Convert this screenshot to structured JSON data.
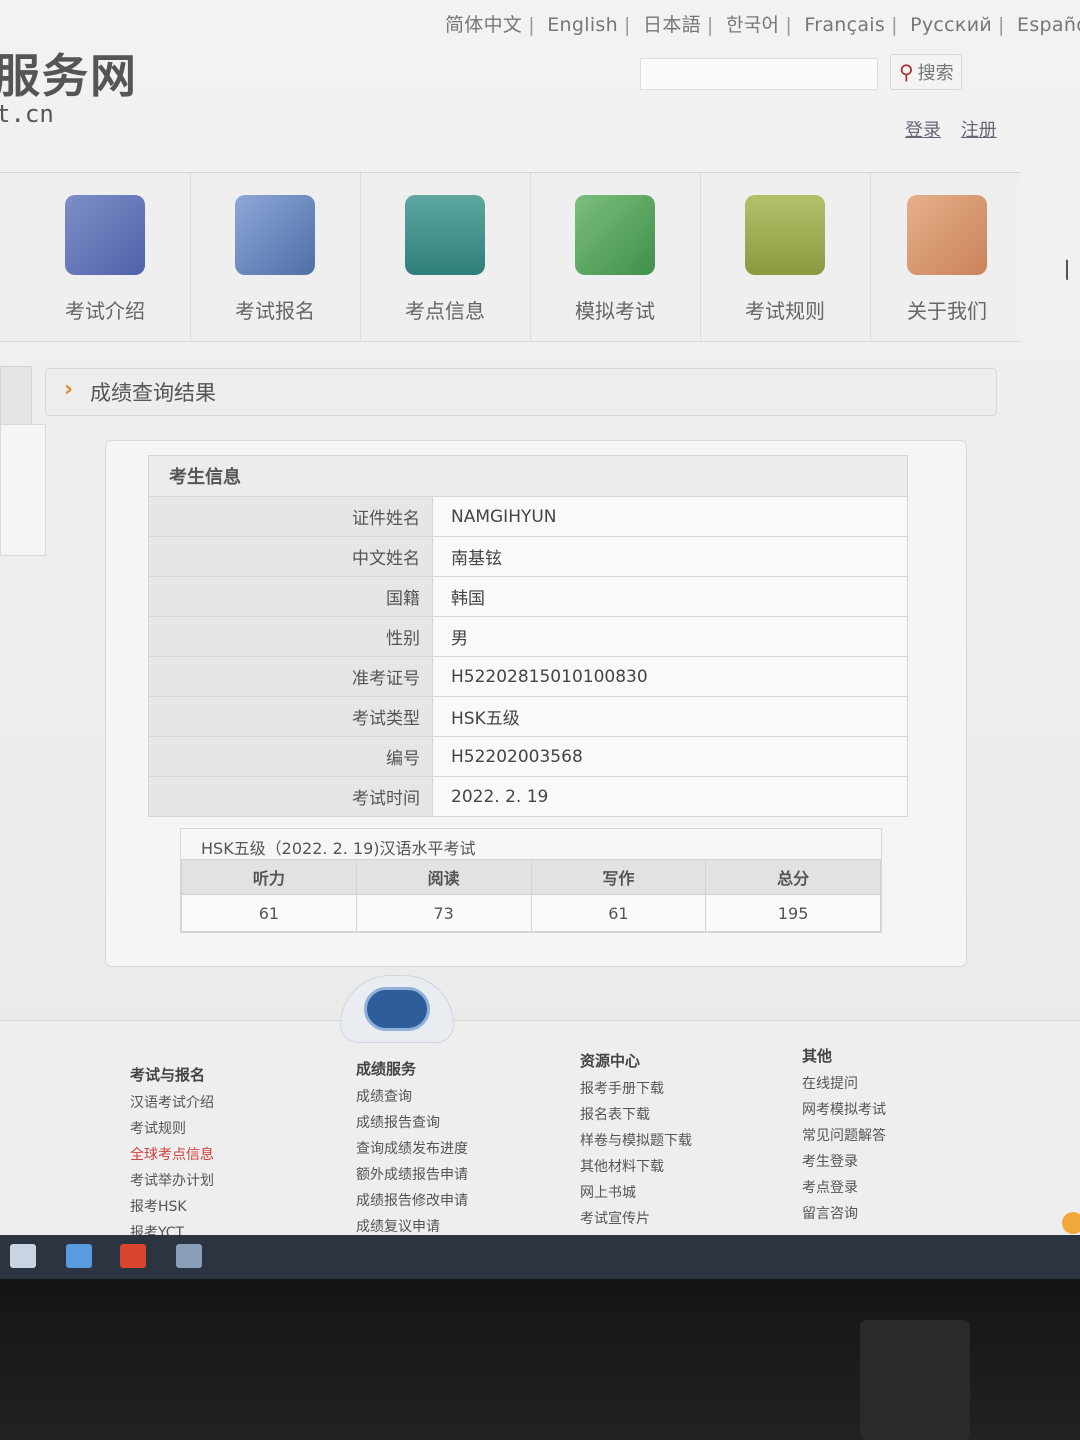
{
  "header": {
    "languages": [
      "简体中文",
      "English",
      "日本語",
      "한국어",
      "Français",
      "Русский",
      "Español"
    ],
    "logo_text": "服务网",
    "logo_domain": "t.cn",
    "search_label": "搜索",
    "login": "登录",
    "register": "注册"
  },
  "nav": {
    "items": [
      {
        "label": "考试介绍",
        "icon": "scroll-icon"
      },
      {
        "label": "考试报名",
        "icon": "pen-scroll-icon"
      },
      {
        "label": "考点信息",
        "icon": "gate-icon"
      },
      {
        "label": "模拟考试",
        "icon": "book-pen-icon"
      },
      {
        "label": "考试规则",
        "icon": "bronze-vessel-icon"
      },
      {
        "label": "关于我们",
        "icon": "pavilion-icon"
      }
    ]
  },
  "section": {
    "title": "成绩查询结果"
  },
  "candidate": {
    "heading": "考生信息",
    "rows": [
      {
        "label": "证件姓名",
        "value": "NAMGIHYUN"
      },
      {
        "label": "中文姓名",
        "value": "南基铉"
      },
      {
        "label": "国籍",
        "value": "韩国"
      },
      {
        "label": "性别",
        "value": "男"
      },
      {
        "label": "准考证号",
        "value": "H52202815010100830"
      },
      {
        "label": "考试类型",
        "value": "HSK五级"
      },
      {
        "label": "编号",
        "value": "H52202003568"
      },
      {
        "label": "考试时间",
        "value": "2022. 2. 19"
      }
    ]
  },
  "scores": {
    "caption": "HSK五级（2022. 2. 19)汉语水平考试",
    "headers": [
      "听力",
      "阅读",
      "写作",
      "总分"
    ],
    "values": [
      "61",
      "73",
      "61",
      "195"
    ]
  },
  "footer": {
    "cols": [
      {
        "head": "考试与报名",
        "links": [
          "汉语考试介绍",
          "考试规则",
          "全球考点信息",
          "考试举办计划",
          "报考HSK",
          "报考YCT"
        ]
      },
      {
        "head": "成绩服务",
        "links": [
          "成绩查询",
          "成绩报告查询",
          "查询成绩发布进度",
          "额外成绩报告申请",
          "成绩报告修改申请",
          "成绩复议申请"
        ]
      },
      {
        "head": "资源中心",
        "links": [
          "报考手册下载",
          "报名表下载",
          "样卷与模拟题下载",
          "其他材料下载",
          "网上书城",
          "考试宣传片"
        ]
      },
      {
        "head": "其他",
        "links": [
          "在线提问",
          "网考模拟考试",
          "常见问题解答",
          "考生登录",
          "考点登录",
          "留言咨询"
        ]
      }
    ],
    "red_link": "全球考点信息"
  },
  "colors": {
    "accent_orange": "#e08a1f",
    "link_red": "#d04040",
    "emblem_blue": "#2e5d9a",
    "taskbar": "#2b3440"
  }
}
